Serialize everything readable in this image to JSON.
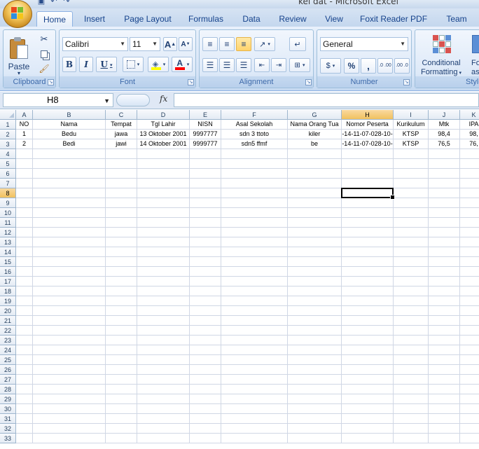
{
  "window": {
    "title": "kel dat - Microsoft Excel"
  },
  "qat": [
    "save-icon",
    "undo-icon",
    "redo-icon"
  ],
  "tabs": [
    {
      "label": "Home",
      "active": true
    },
    {
      "label": "Insert"
    },
    {
      "label": "Page Layout"
    },
    {
      "label": "Formulas"
    },
    {
      "label": "Data"
    },
    {
      "label": "Review"
    },
    {
      "label": "View"
    },
    {
      "label": "Foxit Reader PDF"
    },
    {
      "label": "Team"
    }
  ],
  "ribbon": {
    "clipboard": {
      "label": "Clipboard",
      "paste": "Paste"
    },
    "font": {
      "label": "Font",
      "name": "Calibri",
      "size": "11",
      "bold": "B",
      "italic": "I",
      "underline": "U",
      "grow": "A",
      "shrink": "A",
      "color_letter": "A",
      "fill_color": "#ffff00",
      "font_color": "#ff0000"
    },
    "alignment": {
      "label": "Alignment"
    },
    "number": {
      "label": "Number",
      "format": "General",
      "percent": "%",
      "comma": ",",
      "inc_dec": ".0 .00",
      "dec_dec": ".00 .0"
    },
    "styles": {
      "label": "Style",
      "conditional_1": "Conditional",
      "conditional_2": "Formatting",
      "format_table_1": "Fo",
      "format_table_2": "as T"
    }
  },
  "formula_bar": {
    "name_box": "H8",
    "fx": "fx",
    "content": ""
  },
  "sheet": {
    "columns": [
      "A",
      "B",
      "C",
      "D",
      "E",
      "F",
      "G",
      "H",
      "I",
      "J",
      "K"
    ],
    "selected_column": "H",
    "selected_row": 8,
    "row_count": 33,
    "headers": [
      "NO",
      "Nama",
      "Tempat",
      "Tgl Lahir",
      "NISN",
      "Asal Sekolah",
      "Nama Orang Tua",
      "Nomor Peserta",
      "Kurikulum",
      "Mtk",
      "IPA"
    ],
    "rows": [
      [
        "1",
        "Bedu",
        "jawa",
        "13 Oktober 2001",
        "9997777",
        "sdn 3 ttoto",
        "kiler",
        "-14-11-07-028-10-",
        "KTSP",
        "98,4",
        "98,"
      ],
      [
        "2",
        "Bedi",
        "jawi",
        "14 Oktober 2001",
        "9999777",
        "sdn5 ffmf",
        "be",
        "-14-11-07-028-10-",
        "KTSP",
        "76,5",
        "76,"
      ]
    ]
  }
}
